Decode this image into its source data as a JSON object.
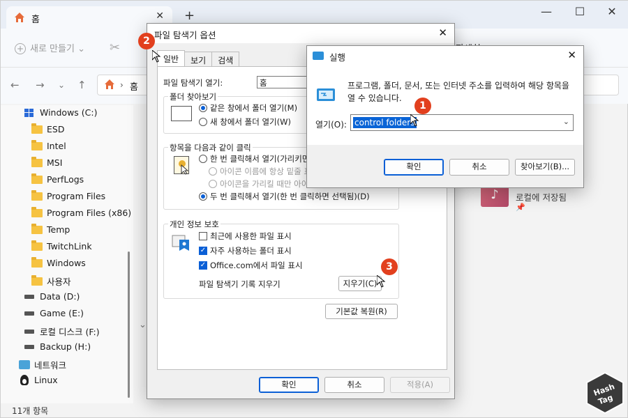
{
  "explorer": {
    "tab_title": "홈",
    "address": "홈",
    "new_label": "새로 만들기",
    "details_label": "자세히",
    "status": "11개 항목",
    "sidebar": [
      {
        "label": "Windows (C:)",
        "icon": "windows-drive-icon"
      },
      {
        "label": "ESD",
        "icon": "folder-icon"
      },
      {
        "label": "Intel",
        "icon": "folder-icon"
      },
      {
        "label": "MSI",
        "icon": "folder-icon"
      },
      {
        "label": "PerfLogs",
        "icon": "folder-icon"
      },
      {
        "label": "Program Files",
        "icon": "folder-icon"
      },
      {
        "label": "Program Files (x86)",
        "icon": "folder-icon"
      },
      {
        "label": "Temp",
        "icon": "folder-icon"
      },
      {
        "label": "TwitchLink",
        "icon": "folder-icon"
      },
      {
        "label": "Windows",
        "icon": "folder-icon"
      },
      {
        "label": "사용자",
        "icon": "folder-icon"
      },
      {
        "label": "Data (D:)",
        "icon": "drive-icon"
      },
      {
        "label": "Game (E:)",
        "icon": "drive-icon"
      },
      {
        "label": "로컬 디스크 (F:)",
        "icon": "drive-icon"
      },
      {
        "label": "Backup (H:)",
        "icon": "drive-icon"
      },
      {
        "label": "네트워크",
        "icon": "network-icon"
      },
      {
        "label": "Linux",
        "icon": "linux-icon"
      }
    ],
    "quick_item": {
      "label": "로컬에 저장됨"
    }
  },
  "folder_options": {
    "title": "파일 탐색기 옵션",
    "tabs": [
      "일반",
      "보기",
      "검색"
    ],
    "open_label": "파일 탐색기 열기:",
    "open_value": "홈",
    "browse_group": "폴더 찾아보기",
    "browse_same": "같은 창에서 폴더 열기(M)",
    "browse_new": "새 창에서 폴더 열기(W)",
    "click_group": "항목을 다음과 같이 클릭",
    "single_click": "한 번 클릭해서 열기(가리키면 선택)(S)",
    "underline_always": "아이콘 이름에 항상 밑줄 표시(I)",
    "underline_hover": "아이콘을 가리킬 때만 아이콘 이름에 밑줄 표시(P)",
    "double_click": "두 번 클릭해서 열기(한 번 클릭하면 선택됨)(D)",
    "privacy_group": "개인 정보 보호",
    "recent_files": "최근에 사용한 파일 표시",
    "frequent_folders": "자주 사용하는 폴더 표시",
    "office_files": "Office.com에서 파일 표시",
    "clear_history_label": "파일 탐색기 기록 지우기",
    "clear_button": "지우기(C)",
    "restore_button": "기본값 복원(R)",
    "ok": "확인",
    "cancel": "취소",
    "apply": "적용(A)"
  },
  "run_dialog": {
    "title": "실행",
    "description": "프로그램, 폴더, 문서, 또는 인터넷 주소를 입력하여 해당 항목을 열 수 있습니다.",
    "open_label": "열기(O):",
    "input_value": "control folders",
    "ok": "확인",
    "cancel": "취소",
    "browse": "찾아보기(B)..."
  },
  "markers": [
    "1",
    "2",
    "3"
  ],
  "watermark": {
    "line1": "Hash",
    "line2": "Tag"
  },
  "colors": {
    "accent": "#0a5fd6",
    "marker": "#e2401e"
  }
}
